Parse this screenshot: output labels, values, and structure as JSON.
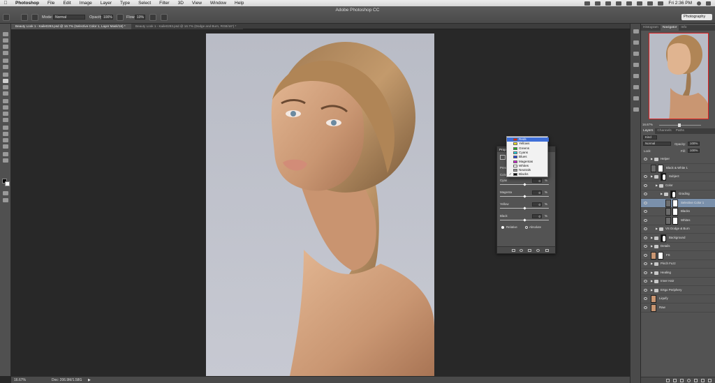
{
  "menubar": {
    "app_name": "Photoshop",
    "items": [
      "File",
      "Edit",
      "Image",
      "Layer",
      "Type",
      "Select",
      "Filter",
      "3D",
      "View",
      "Window",
      "Help"
    ],
    "clock": "Fri 2:36 PM"
  },
  "app_title": "Adobe Photoshop CC",
  "options_bar": {
    "mode_label": "Mode:",
    "mode_value": "Normal",
    "opacity_label": "Opacity:",
    "opacity_value": "100%",
    "flow_label": "Flow:",
    "flow_value": "10%",
    "workspace": "Photography"
  },
  "doc_tabs": [
    {
      "label": "Beauty Look 1 - Kaile0293.psd @ 16.7% (Selective Color 1, Layer Mask/16) *",
      "active": true
    },
    {
      "label": "Beauty Look 1 - Kaile0293.psd @ 16.7% (Dodge and Burn, RGB/16*) *",
      "active": false
    }
  ],
  "status_bar": {
    "zoom": "16.67%",
    "doc_info": "Doc: 206.9M/1.58G"
  },
  "top_panel": {
    "tabs": [
      "Histogram",
      "Navigator",
      "Info"
    ],
    "active_tab": "Navigator",
    "zoom": "16.67%"
  },
  "layers_panel": {
    "tabs": [
      "Layers",
      "Channels",
      "Paths"
    ],
    "active_tab": "Layers",
    "kind_label": "Kind",
    "blend_mode": "Normal",
    "opacity_label": "Opacity:",
    "opacity_value": "100%",
    "lock_label": "Lock:",
    "fill_label": "Fill:",
    "fill_value": "100%",
    "layers": [
      {
        "name": "Helper",
        "type": "group",
        "indent": 0,
        "visible": true
      },
      {
        "name": "Black & White 1",
        "type": "adjustment",
        "indent": 0,
        "visible": false
      },
      {
        "name": "Subject",
        "type": "group-mask",
        "indent": 0,
        "visible": true
      },
      {
        "name": "Color",
        "type": "group",
        "indent": 1,
        "visible": true
      },
      {
        "name": "Grading",
        "type": "group-mask",
        "indent": 2,
        "visible": true
      },
      {
        "name": "Selective Color 1",
        "type": "adjustment",
        "indent": 3,
        "visible": true,
        "selected": true
      },
      {
        "name": "Blacks",
        "type": "adjustment",
        "indent": 3,
        "visible": true
      },
      {
        "name": "Whites",
        "type": "adjustment",
        "indent": 3,
        "visible": true
      },
      {
        "name": "VS Dodge & Burn",
        "type": "group",
        "indent": 1,
        "visible": true
      },
      {
        "name": "Background",
        "type": "group-mask",
        "indent": 0,
        "visible": true
      },
      {
        "name": "Details",
        "type": "group",
        "indent": 0,
        "visible": true
      },
      {
        "name": "FS",
        "type": "image-mask",
        "indent": 0,
        "visible": true
      },
      {
        "name": "Pinch Fuzz",
        "type": "group",
        "indent": 0,
        "visible": true
      },
      {
        "name": "Healing",
        "type": "group",
        "indent": 0,
        "visible": true
      },
      {
        "name": "Inner Hair",
        "type": "group",
        "indent": 0,
        "visible": true
      },
      {
        "name": "Ertgo Periphery",
        "type": "group",
        "indent": 0,
        "visible": true
      },
      {
        "name": "Liquify",
        "type": "image",
        "indent": 0,
        "visible": true
      },
      {
        "name": "Raw",
        "type": "image",
        "indent": 0,
        "visible": true
      }
    ]
  },
  "properties_panel": {
    "title": "Properties",
    "preset_label": "Preset:",
    "colors_label": "Colors:",
    "sliders": [
      {
        "label": "Cyan",
        "value": "0",
        "unit": "%",
        "level": 0.5
      },
      {
        "label": "Magenta",
        "value": "0",
        "unit": "%",
        "level": 0.5
      },
      {
        "label": "Yellow",
        "value": "0",
        "unit": "%",
        "level": 0.5
      },
      {
        "label": "Black",
        "value": "0",
        "unit": "%",
        "level": 0.5
      }
    ],
    "method_relative": "Relative",
    "method_absolute": "Absolute",
    "method_selected": "Relative"
  },
  "colors_dropdown": {
    "items": [
      {
        "label": "Reds",
        "color": "#e02020",
        "highlight": true,
        "checked": false
      },
      {
        "label": "Yellows",
        "color": "#f0e020",
        "highlight": false,
        "checked": false
      },
      {
        "label": "Greens",
        "color": "#20b020",
        "highlight": false,
        "checked": false
      },
      {
        "label": "Cyans",
        "color": "#20d0e0",
        "highlight": false,
        "checked": false
      },
      {
        "label": "Blues",
        "color": "#2040e0",
        "highlight": false,
        "checked": false
      },
      {
        "label": "Magentas",
        "color": "#d020d0",
        "highlight": false,
        "checked": false
      },
      {
        "label": "Whites",
        "color": "#ffffff",
        "highlight": false,
        "checked": false
      },
      {
        "label": "Neutrals",
        "color": "#909090",
        "highlight": false,
        "checked": false
      },
      {
        "label": "Blacks",
        "color": "#000000",
        "highlight": false,
        "checked": true
      }
    ]
  },
  "colors": {
    "accent_blue": "#3f6fd8",
    "selected_layer": "#7a90ab",
    "panel_bg": "#535353",
    "canvas_bg": "#282828"
  }
}
